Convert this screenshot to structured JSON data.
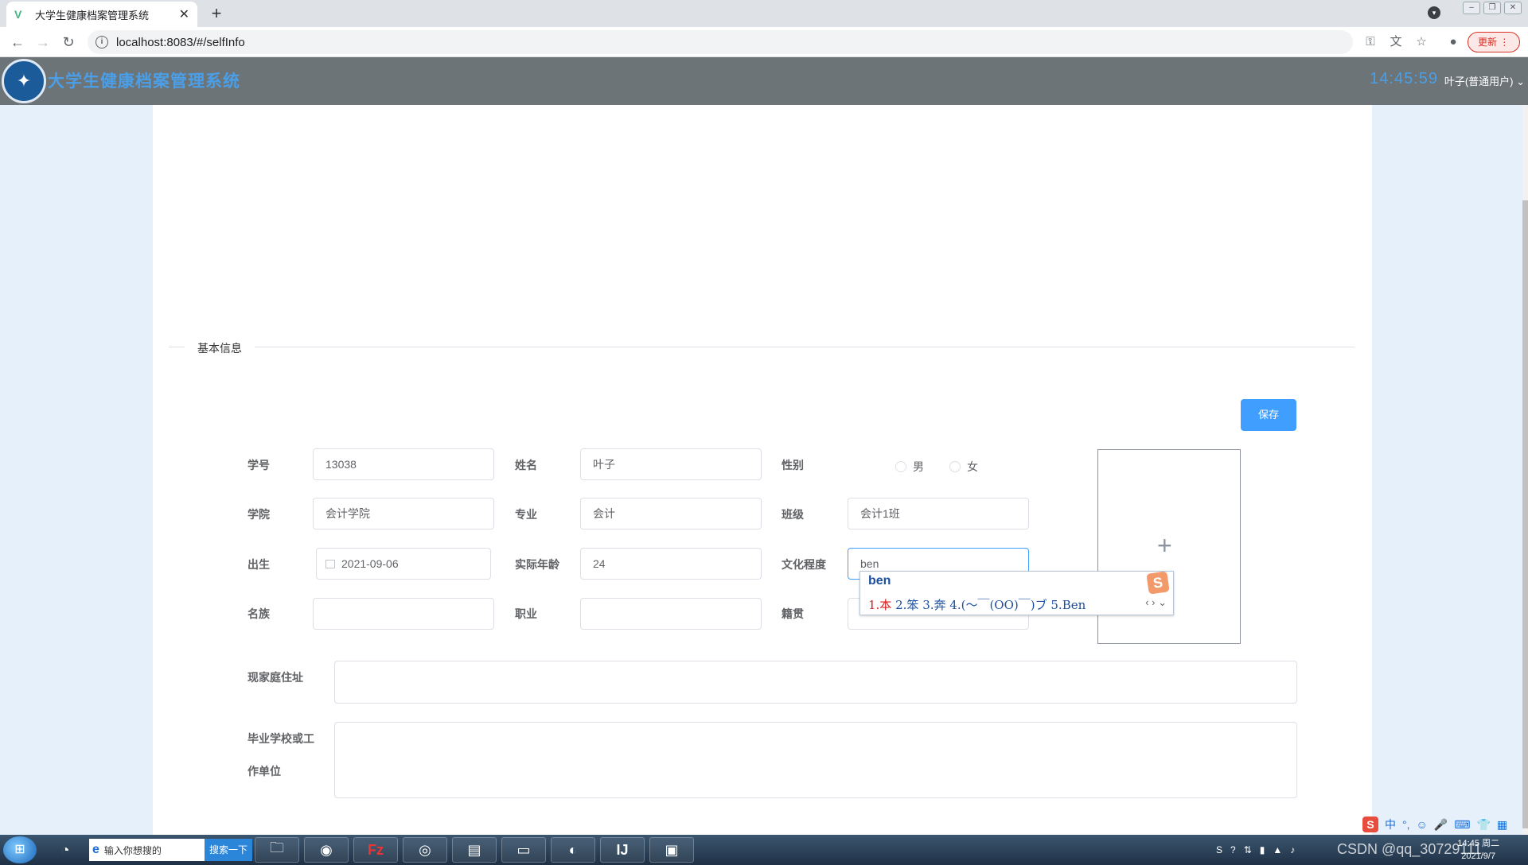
{
  "browser": {
    "tab_title": "大学生健康档案管理系统",
    "tab_close": "✕",
    "new_tab": "+",
    "url": "localhost:8083/#/selfInfo",
    "update_label": "更新 ⋮"
  },
  "app": {
    "title": "大学生健康档案管理系统",
    "clock": "14:45:59",
    "user": "叶子(普通用户) ⌄"
  },
  "section": {
    "title": "基本信息"
  },
  "actions": {
    "save": "保存"
  },
  "form": {
    "student_id": {
      "label": "学号",
      "value": "13038"
    },
    "name": {
      "label": "姓名",
      "value": "叶子"
    },
    "gender": {
      "label": "性别",
      "options": [
        "男",
        "女"
      ]
    },
    "college": {
      "label": "学院",
      "value": "会计学院"
    },
    "major": {
      "label": "专业",
      "value": "会计"
    },
    "class": {
      "label": "班级",
      "value": "会计1班"
    },
    "birth": {
      "label": "出生",
      "value": "2021-09-06"
    },
    "age": {
      "label": "实际年龄",
      "value": "24"
    },
    "education": {
      "label": "文化程度",
      "value": "ben"
    },
    "ethnicity": {
      "label": "名族",
      "value": ""
    },
    "occupation": {
      "label": "职业",
      "value": ""
    },
    "native_place": {
      "label": "籍贯",
      "value": ""
    },
    "address": {
      "label": "现家庭住址",
      "value": ""
    },
    "school_line1": "毕业学校或工",
    "school_line2": "作单位",
    "upload_plus": "+"
  },
  "ime": {
    "composition": "ben",
    "candidates": [
      "1.本",
      "2.笨",
      "3.奔",
      "4.(～￣(OO)￣)ブ",
      "5.Ben"
    ],
    "logo": "S",
    "arrows": "‹ › ⌄"
  },
  "taskbar": {
    "search_placeholder": "输入你想搜的",
    "search_button": "搜索一下",
    "watermark": "CSDN @qq_30729111",
    "clock_time": "14:45 周二",
    "clock_date": "2021/9/7",
    "ime_mode": "中"
  }
}
